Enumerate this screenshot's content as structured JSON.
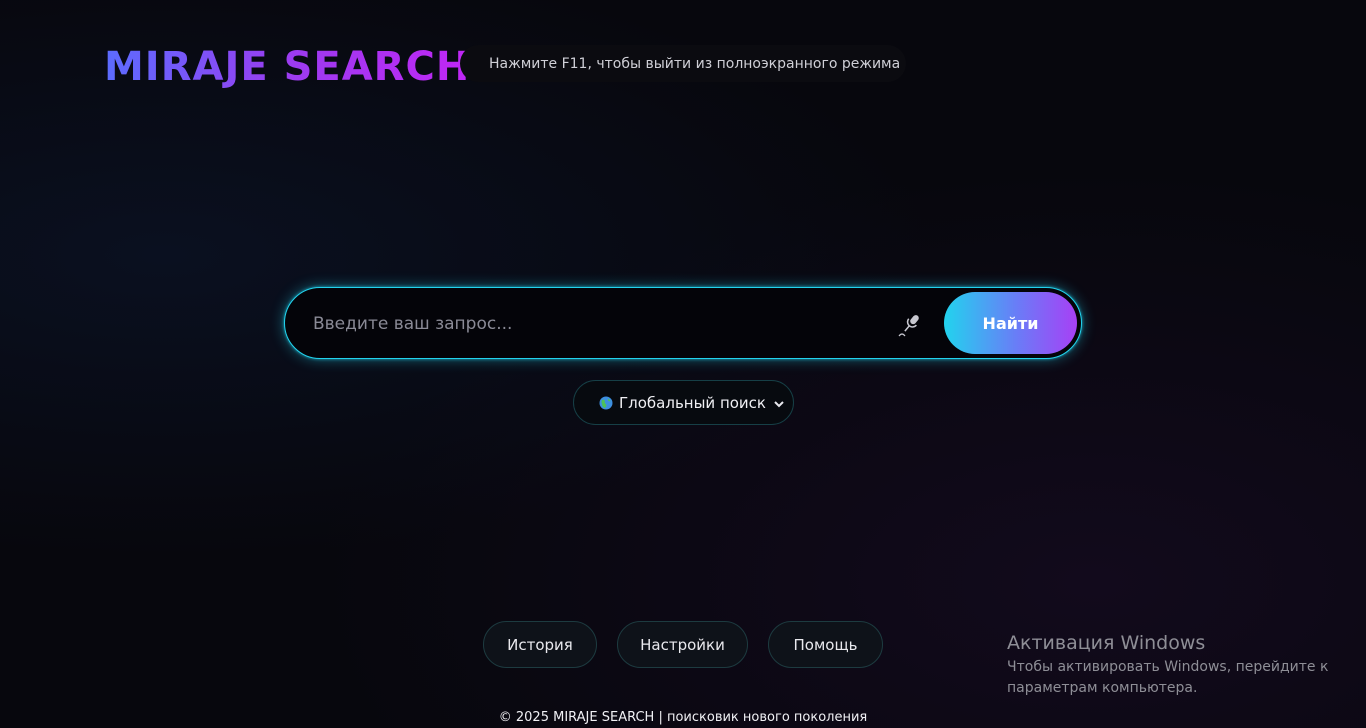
{
  "header": {
    "logo_text": "MIRAJE SEARCH",
    "fullscreen_hint": "Нажмите F11, чтобы выйти из полноэкранного режима"
  },
  "search": {
    "placeholder": "Введите ваш запрос...",
    "value": "",
    "voice_icon": "microphone-icon",
    "submit_label": "Найти"
  },
  "scope": {
    "icon": "globe-icon",
    "selected": "Глобальный поиск"
  },
  "nav": {
    "history": "История",
    "settings": "Настройки",
    "help": "Помощь"
  },
  "footer": {
    "text": "© 2025 MIRAJE SEARCH | поисковик нового поколения"
  },
  "windows_activation": {
    "title": "Активация Windows",
    "line1": "Чтобы активировать Windows, перейдите к",
    "line2": "параметрам компьютера."
  },
  "colors": {
    "accent_cyan": "#22d3ee",
    "accent_purple": "#a740f5",
    "background": "#07070d"
  }
}
